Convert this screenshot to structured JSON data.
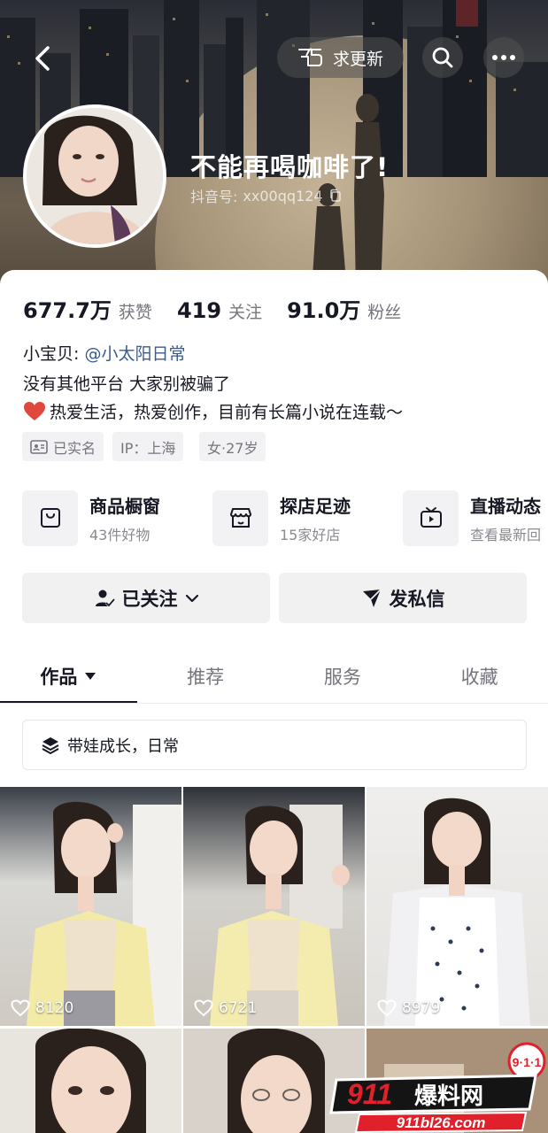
{
  "header": {
    "update_button_label": "求更新",
    "nickname": "不能再喝咖啡了!",
    "douyin_id_label": "抖音号:",
    "douyin_id": "xx00qq124"
  },
  "stats": [
    {
      "value": "677.7万",
      "label": "获赞"
    },
    {
      "value": "419",
      "label": "关注"
    },
    {
      "value": "91.0万",
      "label": "粉丝"
    }
  ],
  "bio": {
    "line1_prefix": "小宝贝:",
    "line1_link": "@小太阳日常",
    "line2": "没有其他平台 大家别被骗了",
    "line3": "热爱生活，热爱创作，目前有长篇小说在连载～"
  },
  "tags": [
    {
      "label": "已实名",
      "icon": "id-card-icon"
    },
    {
      "label": "IP：上海"
    },
    {
      "label": "女·27岁"
    }
  ],
  "services": [
    {
      "title": "商品橱窗",
      "subtitle": "43件好物",
      "icon": "shopping-bag-icon"
    },
    {
      "title": "探店足迹",
      "subtitle": "15家好店",
      "icon": "storefront-icon"
    },
    {
      "title": "直播动态",
      "subtitle": "查看最新回",
      "icon": "tv-icon"
    }
  ],
  "actions": {
    "followed_label": "已关注",
    "message_label": "发私信"
  },
  "tabs": [
    {
      "label": "作品",
      "active": true
    },
    {
      "label": "推荐",
      "active": false
    },
    {
      "label": "服务",
      "active": false
    },
    {
      "label": "收藏",
      "active": false
    }
  ],
  "collection": {
    "label": "带娃成长，日常",
    "icon": "layers-icon"
  },
  "videos": [
    {
      "likes": "8120"
    },
    {
      "likes": "6721"
    },
    {
      "likes": "8979"
    }
  ],
  "watermark": {
    "badge": "9·1·1",
    "brand_num": "911",
    "brand_text": "爆料网",
    "url": "911bl26.com"
  },
  "colors": {
    "link": "#3a5b8f",
    "heart": "#e0483e",
    "watermark_red": "#e0202a"
  }
}
